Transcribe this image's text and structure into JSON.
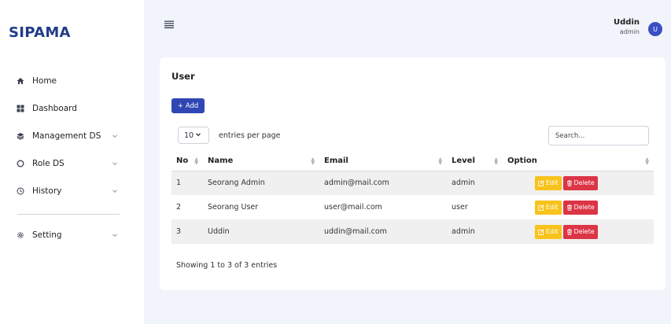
{
  "brand": "SIPAMA",
  "sidebar": {
    "items": [
      {
        "label": "Home",
        "icon": "home-icon",
        "has_chevron": false
      },
      {
        "label": "Dashboard",
        "icon": "grid-icon",
        "has_chevron": false
      },
      {
        "label": "Management DS",
        "icon": "layers-icon",
        "has_chevron": true
      },
      {
        "label": "Role DS",
        "icon": "circle-icon",
        "has_chevron": true
      },
      {
        "label": "History",
        "icon": "clock-icon",
        "has_chevron": true
      },
      {
        "label": "Setting",
        "icon": "gear-icon",
        "has_chevron": true
      }
    ]
  },
  "header": {
    "user_name": "Uddin",
    "user_role": "admin",
    "avatar_letter": "U"
  },
  "card": {
    "title": "User",
    "add_label": "Add",
    "per_page_value": "10",
    "per_page_label": "entries per page",
    "search_placeholder": "Search...",
    "columns": [
      "No",
      "Name",
      "Email",
      "Level",
      "Option"
    ],
    "rows": [
      {
        "no": "1",
        "name": "Seorang Admin",
        "email": "admin@mail.com",
        "level": "admin"
      },
      {
        "no": "2",
        "name": "Seorang User",
        "email": "user@mail.com",
        "level": "user"
      },
      {
        "no": "3",
        "name": "Uddin",
        "email": "uddin@mail.com",
        "level": "admin"
      }
    ],
    "edit_label": "Edit",
    "delete_label": "Delete",
    "info": "Showing 1 to 3 of 3 entries"
  },
  "colors": {
    "primary": "#2f46b3",
    "brand": "#1f3c88",
    "edit": "#f7c31c",
    "delete": "#dc3545",
    "background": "#f1f4fb"
  }
}
